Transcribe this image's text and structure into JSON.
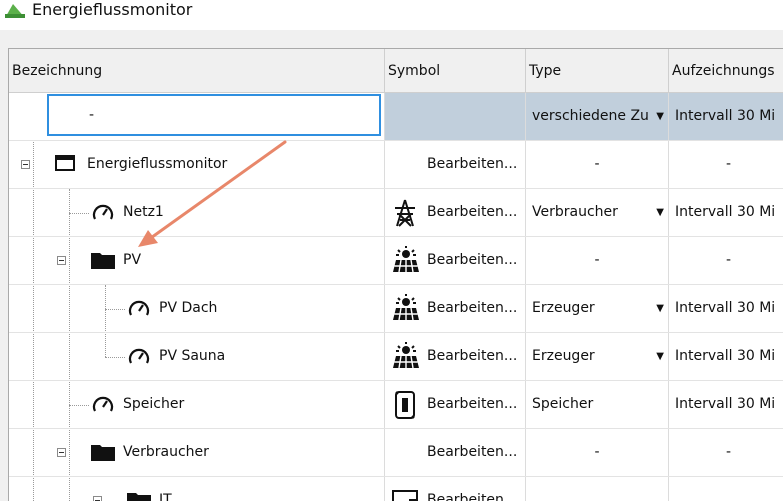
{
  "window": {
    "title": "Energieflussmonitor"
  },
  "columns": [
    "Bezeichnung",
    "Symbol",
    "Type",
    "Aufzeichnungs"
  ],
  "rows": [
    {
      "name": "-",
      "symbol": "",
      "type": "verschiedene Zu",
      "record": "Intervall 30 Mi",
      "icon": ""
    },
    {
      "name": "Energieflussmonitor",
      "symbol": "Bearbeiten...",
      "type": "-",
      "record": "-",
      "icon": "window-icon"
    },
    {
      "name": "Netz1",
      "symbol": "Bearbeiten...",
      "type": "Verbraucher",
      "record": "Intervall 30 Mi",
      "icon": "gauge-icon"
    },
    {
      "name": "PV",
      "symbol": "Bearbeiten...",
      "type": "-",
      "record": "-",
      "icon": "folder-icon"
    },
    {
      "name": "PV Dach",
      "symbol": "Bearbeiten...",
      "type": "Erzeuger",
      "record": "Intervall 30 Mi",
      "icon": "gauge-icon"
    },
    {
      "name": "PV Sauna",
      "symbol": "Bearbeiten...",
      "type": "Erzeuger",
      "record": "Intervall 30 Mi",
      "icon": "gauge-icon"
    },
    {
      "name": "Speicher",
      "symbol": "Bearbeiten...",
      "type": "Speicher",
      "record": "Intervall 30 Mi",
      "icon": "gauge-icon"
    },
    {
      "name": "Verbraucher",
      "symbol": "Bearbeiten...",
      "type": "-",
      "record": "-",
      "icon": "folder-icon"
    },
    {
      "name": "IT",
      "symbol": "Bearbeiten...",
      "type": "",
      "record": "",
      "icon": "folder-icon"
    }
  ],
  "colors": {
    "selection_border": "#2f8fe0",
    "selection_fill": "#c1cfdc",
    "arrow": "#e8876a"
  }
}
